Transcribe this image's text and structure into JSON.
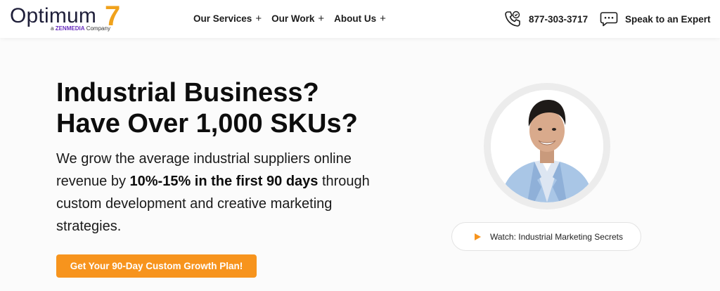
{
  "logo": {
    "name": "Optimum",
    "number": "7",
    "sub_prefix": "a",
    "sub_brand": "ZENMEDIA",
    "sub_suffix": "Company"
  },
  "nav": {
    "items": [
      {
        "label": "Our Services",
        "icon": "plus-icon"
      },
      {
        "label": "Our Work",
        "icon": "plus-icon"
      },
      {
        "label": "About Us",
        "icon": "plus-icon"
      }
    ]
  },
  "contact": {
    "phone": "877-303-3717",
    "phone_icon": "phone-icon",
    "expert_label": "Speak to an Expert",
    "expert_icon": "chat-icon"
  },
  "hero": {
    "title_line1": "Industrial Business?",
    "title_line2": "Have Over 1,000 SKUs?",
    "body_part1": "We grow the average industrial suppliers online revenue by ",
    "body_bold": "10%-15% in the first 90 days",
    "body_part2": " through custom development and creative marketing strategies.",
    "cta_label": "Get Your 90-Day Custom Growth Plan!"
  },
  "video": {
    "label": "Watch: Industrial Marketing Secrets",
    "icon": "play-icon"
  },
  "colors": {
    "accent": "#f7941d",
    "zenmedia": "#6a2fbf",
    "text": "#0d0d0d"
  }
}
